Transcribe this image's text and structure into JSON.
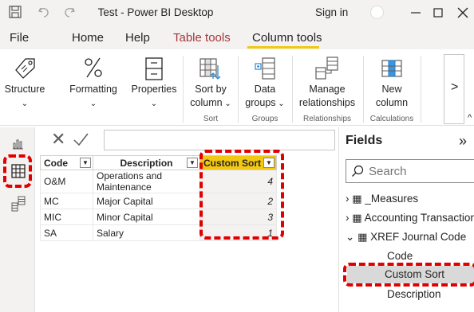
{
  "window": {
    "title": "Test - Power BI Desktop",
    "sign_in": "Sign in"
  },
  "menu": {
    "tabs": [
      "File",
      "Home",
      "Help",
      "Table tools",
      "Column tools"
    ],
    "active_tab": "Column tools"
  },
  "ribbon": {
    "buttons": [
      {
        "label": "Structure",
        "icon": "structure-icon"
      },
      {
        "label": "Formatting",
        "icon": "percent-icon"
      },
      {
        "label": "Properties",
        "icon": "properties-icon"
      },
      {
        "label": "Sort by column",
        "line1": "Sort by",
        "line2": "column",
        "icon": "sort-by-column-icon"
      },
      {
        "label": "Data groups",
        "line1": "Data",
        "line2": "groups",
        "icon": "data-groups-icon"
      },
      {
        "label": "Manage relationships",
        "line1": "Manage",
        "line2": "relationships",
        "icon": "manage-relationships-icon"
      },
      {
        "label": "New column",
        "line1": "New",
        "line2": "column",
        "icon": "new-column-icon"
      }
    ],
    "groups": [
      "Sort",
      "Groups",
      "Relationships",
      "Calculations"
    ],
    "more": ">"
  },
  "left_rail": [
    "report-view-icon",
    "data-view-icon",
    "model-view-icon"
  ],
  "formula_bar": {
    "value": ""
  },
  "table": {
    "columns": [
      "Code",
      "Description",
      "Custom Sort"
    ],
    "selected_column": "Custom Sort",
    "rows": [
      {
        "code": "O&M",
        "description": "Operations and Maintenance",
        "custom_sort": "4"
      },
      {
        "code": "MC",
        "description": "Major Capital",
        "custom_sort": "2"
      },
      {
        "code": "MIC",
        "description": "Minor Capital",
        "custom_sort": "3"
      },
      {
        "code": "SA",
        "description": "Salary",
        "custom_sort": "1"
      }
    ]
  },
  "fields": {
    "title": "Fields",
    "collapse": "»",
    "search_placeholder": "Search",
    "tables": [
      {
        "name": "_Measures",
        "expanded": false
      },
      {
        "name": "Accounting Transactions",
        "expanded": false
      },
      {
        "name": "XREF Journal Code",
        "expanded": true
      }
    ],
    "columns": [
      "Code",
      "Custom Sort",
      "Description"
    ],
    "selected_column": "Custom Sort"
  },
  "colors": {
    "accent": "#f2c811",
    "highlight_red": "#e00000",
    "tool_tab": "#a4373a"
  }
}
